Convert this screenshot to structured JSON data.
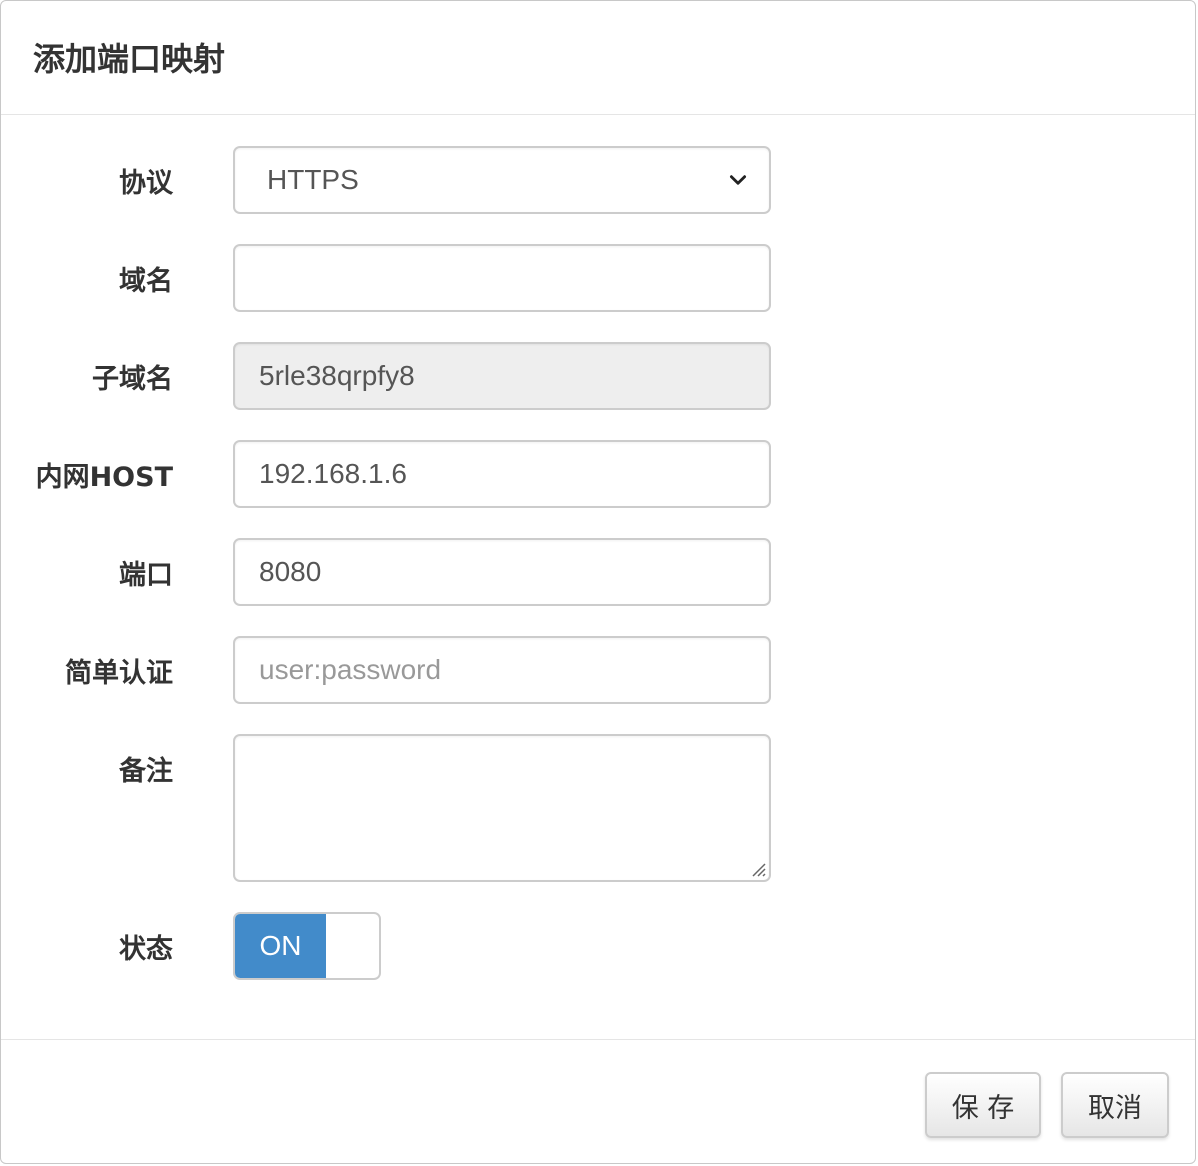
{
  "modal": {
    "title": "添加端口映射"
  },
  "form": {
    "protocol": {
      "label": "协议",
      "value": "HTTPS"
    },
    "domain": {
      "label": "域名",
      "value": ""
    },
    "subdomain": {
      "label": "子域名",
      "value": "5rle38qrpfy8"
    },
    "lan_host": {
      "label": "内网HOST",
      "value": "192.168.1.6"
    },
    "port": {
      "label": "端口",
      "value": "8080"
    },
    "basic_auth": {
      "label": "简单认证",
      "value": "",
      "placeholder": "user:password"
    },
    "remark": {
      "label": "备注",
      "value": ""
    },
    "status": {
      "label": "状态",
      "value": "ON"
    }
  },
  "footer": {
    "save_label": "保 存",
    "cancel_label": "取消"
  },
  "colors": {
    "switch_on": "#428bca",
    "readonly_bg": "#eeeeee"
  },
  "icons": {
    "select_arrow": "chevron-down-icon",
    "textarea_resize": "resize-grip-icon"
  }
}
